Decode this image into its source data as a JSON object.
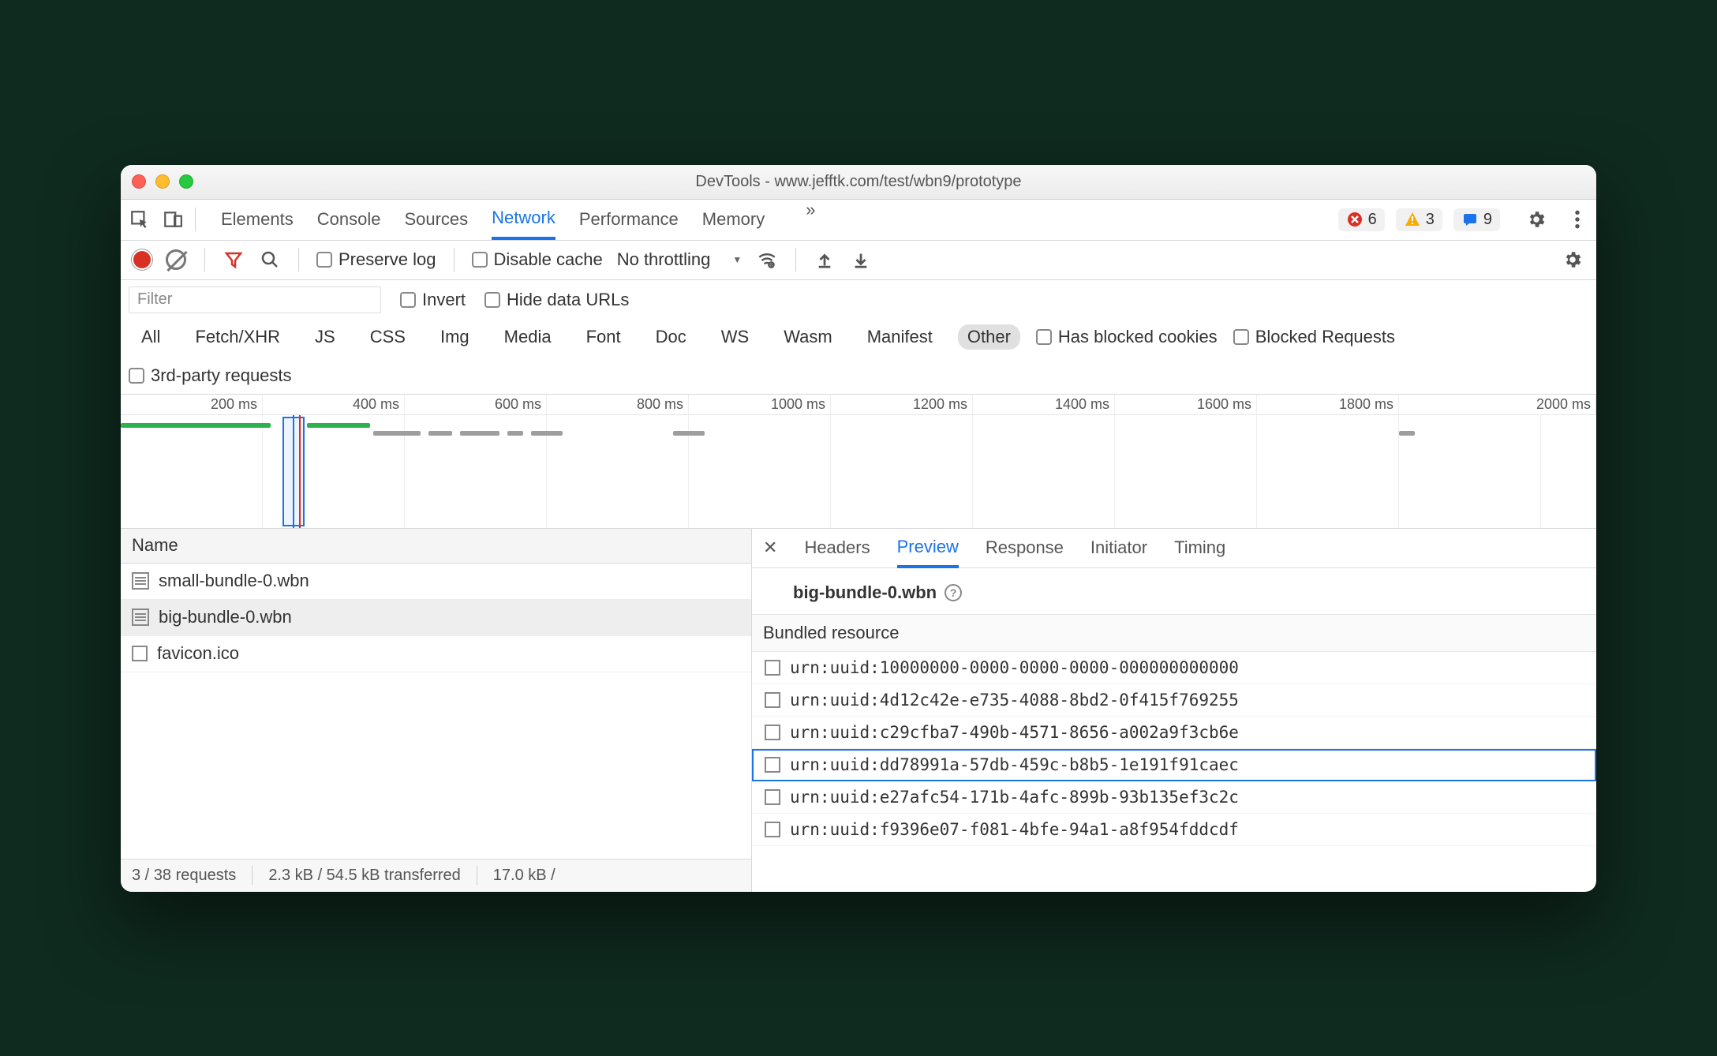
{
  "window": {
    "title": "DevTools - www.jefftk.com/test/wbn9/prototype"
  },
  "panel_tabs": {
    "items": [
      "Elements",
      "Console",
      "Sources",
      "Network",
      "Performance",
      "Memory"
    ],
    "active": "Network",
    "more_hidden": true,
    "counters": {
      "errors": "6",
      "warnings": "3",
      "messages": "9"
    }
  },
  "toolbar": {
    "preserve_log": "Preserve log",
    "disable_cache": "Disable cache",
    "throttling": "No throttling"
  },
  "filter": {
    "placeholder": "Filter",
    "invert": "Invert",
    "hide_data_urls": "Hide data URLs",
    "types": [
      "All",
      "Fetch/XHR",
      "JS",
      "CSS",
      "Img",
      "Media",
      "Font",
      "Doc",
      "WS",
      "Wasm",
      "Manifest",
      "Other"
    ],
    "active_type": "Other",
    "has_blocked_cookies": "Has blocked cookies",
    "blocked_requests": "Blocked Requests",
    "third_party": "3rd-party requests"
  },
  "timeline": {
    "ticks": [
      "200 ms",
      "400 ms",
      "600 ms",
      "800 ms",
      "1000 ms",
      "1200 ms",
      "1400 ms",
      "1600 ms",
      "1800 ms",
      "2000 ms"
    ]
  },
  "requests": {
    "column_name": "Name",
    "rows": [
      {
        "name": "small-bundle-0.wbn",
        "icon": "file"
      },
      {
        "name": "big-bundle-0.wbn",
        "icon": "file",
        "selected": true
      },
      {
        "name": "favicon.ico",
        "icon": "blank"
      }
    ],
    "status": {
      "count": "3 / 38 requests",
      "transferred": "2.3 kB / 54.5 kB transferred",
      "resources": "17.0 kB /"
    }
  },
  "detail": {
    "tabs": [
      "Headers",
      "Preview",
      "Response",
      "Initiator",
      "Timing"
    ],
    "active": "Preview",
    "title": "big-bundle-0.wbn",
    "section": "Bundled resource",
    "resources": [
      "urn:uuid:10000000-0000-0000-0000-000000000000",
      "urn:uuid:4d12c42e-e735-4088-8bd2-0f415f769255",
      "urn:uuid:c29cfba7-490b-4571-8656-a002a9f3cb6e",
      "urn:uuid:dd78991a-57db-459c-b8b5-1e191f91caec",
      "urn:uuid:e27afc54-171b-4afc-899b-93b135ef3c2c",
      "urn:uuid:f9396e07-f081-4bfe-94a1-a8f954fddcdf"
    ],
    "selected_resource_index": 3
  }
}
